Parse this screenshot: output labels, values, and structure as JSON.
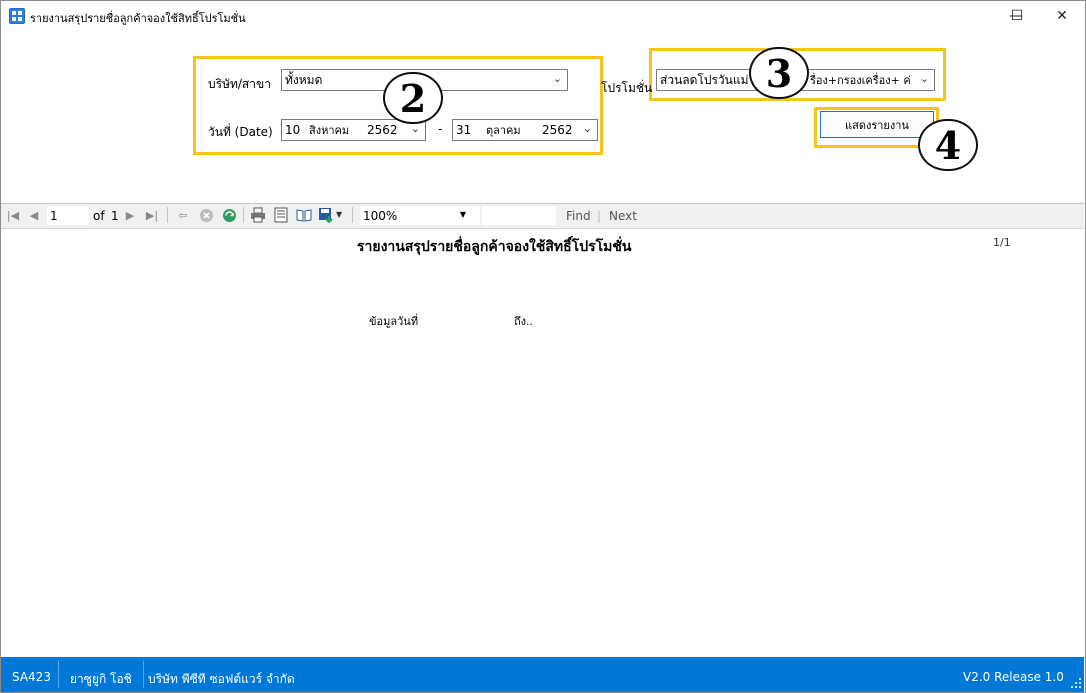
{
  "window": {
    "title": "รายงานสรุปรายชื่อลูกค้าจองใช้สิทธิ์โปรโมชั่น",
    "min_glyph": "—",
    "max_glyph": "☐",
    "close_glyph": "✕"
  },
  "filters": {
    "company_label": "บริษัท/สาขา",
    "company_value": "ทั้งหมด",
    "date_label": "วันที่ (Date)",
    "date_from": {
      "day": "10",
      "month": "สิงหาคม",
      "year": "2562"
    },
    "date_separator": "-",
    "date_to": {
      "day": "31",
      "month": "ตุลาคม",
      "year": "2562"
    },
    "promotion_label": "โปรโมชั่น",
    "promotion_value_left": "ส่วนลดโปรวันแม่ 2",
    "promotion_value_right": "รื่อง+กรองเครื่อง+ ค่"
  },
  "show_report_button": "แสดงรายงาน",
  "annotations": {
    "two": "2",
    "three": "3",
    "four": "4"
  },
  "viewer_toolbar": {
    "page_current": "1",
    "page_of": "of",
    "page_total": "1",
    "zoom": "100%",
    "find_label": "Find",
    "divider": "|",
    "next_label": "Next"
  },
  "report": {
    "title": "รายงานสรุปรายชื่อลูกค้าจองใช้สิทธิ์โปรโมชั่น",
    "page_indicator": "1/1",
    "date_from_label": "ข้อมูลวันที่",
    "date_to_label": "ถึง.."
  },
  "status_bar": {
    "code": "SA423",
    "user": "ยาซูยูกิ  โอชิ",
    "company": "บริษัท พีซีที ซอฟต์แวร์ จำกัด",
    "version": "V2.0 Release 1.0"
  },
  "colors": {
    "highlight": "#f5c518",
    "status_bar": "#0078d7",
    "button_border": "#1f6fcf"
  }
}
